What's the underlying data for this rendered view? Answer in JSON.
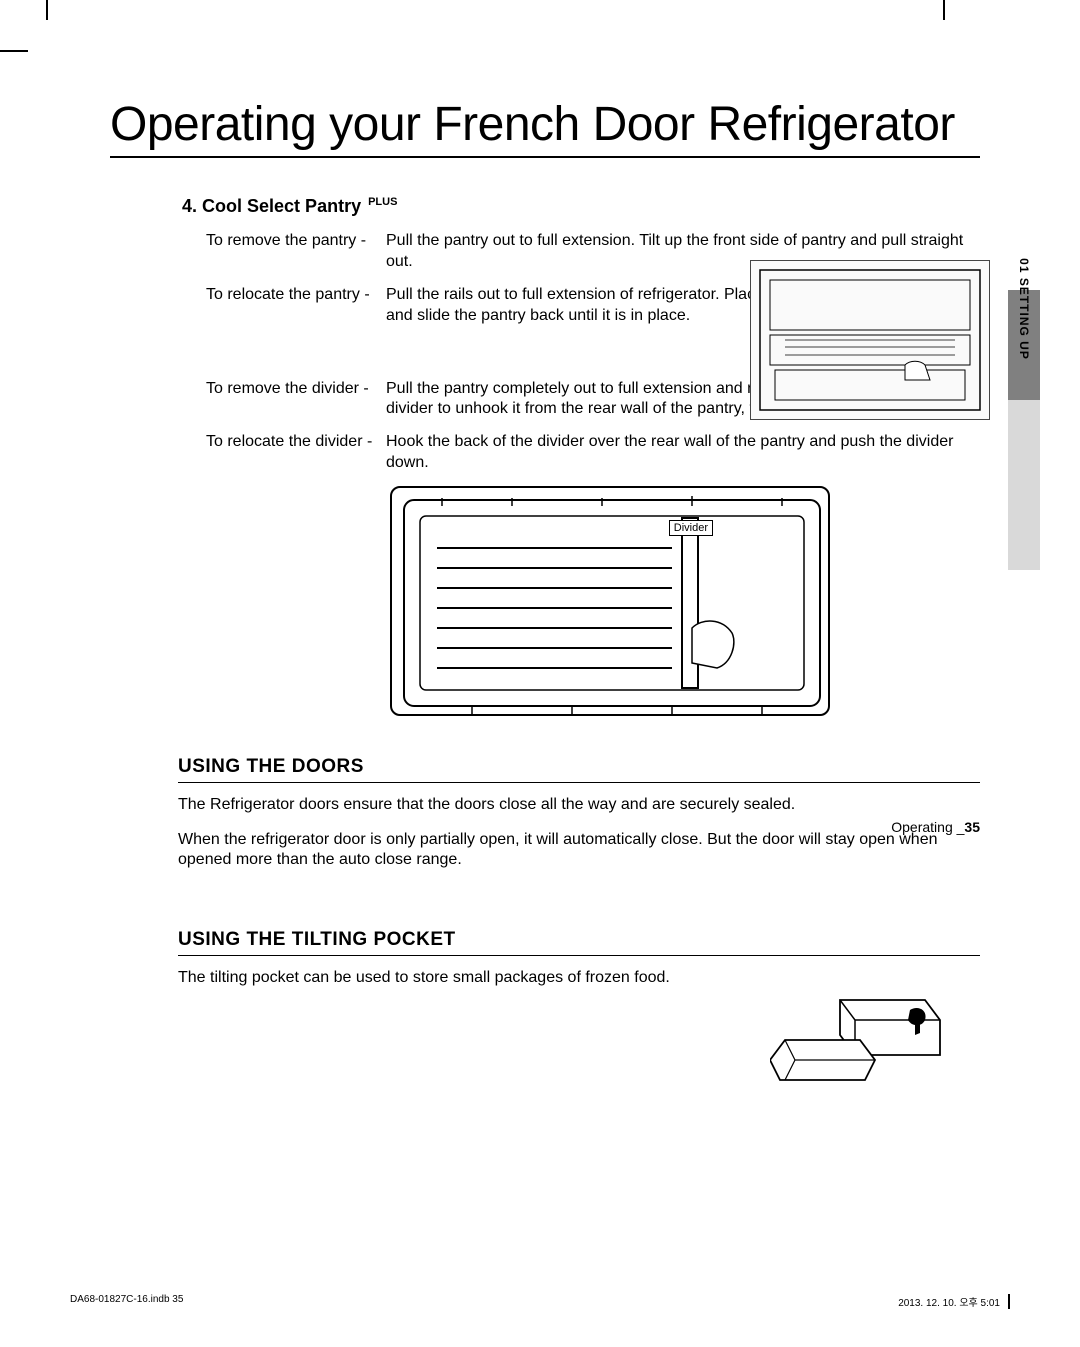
{
  "title": "Operating your French Door Refrigerator",
  "section4": {
    "number": "4.",
    "title": "Cool Select Pantry",
    "sup": "PLUS",
    "items": [
      {
        "label": "To remove the pantry -",
        "text": "Pull the pantry out to full extension. Tilt up the front side of pantry and pull straight out."
      },
      {
        "label": "To relocate the pantry -",
        "text": "Pull the rails out to full extension of refrigerator. Place the drawer onto the rails and slide the pantry back until it is in place."
      },
      {
        "label": "To remove the divider -",
        "text": "Pull the pantry completely out to full extension and raise the front side of the divider to unhook it from the rear wall of the pantry, then lift the divider out."
      },
      {
        "label": "To relocate the divider -",
        "text": "Hook the back of the divider over the rear wall of the pantry and push the divider down."
      }
    ]
  },
  "dividerLabel": "Divider",
  "sideTab": "01 SETTING UP",
  "doors": {
    "heading": "USING THE DOORS",
    "p1": "The Refrigerator doors ensure that the doors close all the way and are securely sealed.",
    "p2": "When the refrigerator door is only partially open, it will automatically close. But the door will stay open when opened more than the auto close range."
  },
  "tilting": {
    "heading": "USING THE TILTING POCKET",
    "p1": "The tilting pocket can be used to store small packages of frozen food."
  },
  "footer": {
    "section": "Operating _",
    "page": "35"
  },
  "printFooter": {
    "left": "DA68-01827C-16.indb   35",
    "right": "2013. 12. 10.   오후 5:01"
  }
}
